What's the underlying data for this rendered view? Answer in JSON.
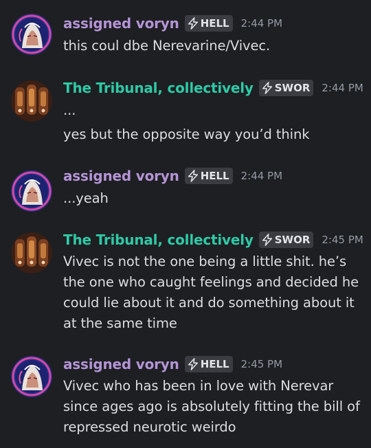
{
  "colors": {
    "background": "#1e1f22",
    "voryn_name": "#b494d6",
    "tribunal_name": "#2fc9a7",
    "message_text": "#dbdee1",
    "timestamp": "#949ba4",
    "tag_bg": "#3a3c41"
  },
  "messages": [
    {
      "author": "assigned voryn",
      "tag": "HELL",
      "tag_icon": "lightning-bolt-icon",
      "time": "2:44 PM",
      "lines": [
        "this coul dbe Nerevarine/Vivec."
      ]
    },
    {
      "author": "The Tribunal, collectively",
      "tag": "SWOR",
      "tag_icon": "lightning-bolt-icon",
      "time": "2:44 PM",
      "lines": [
        "...",
        "yes but the opposite way you’d think"
      ]
    },
    {
      "author": "assigned voryn",
      "tag": "HELL",
      "tag_icon": "lightning-bolt-icon",
      "time": "2:44 PM",
      "lines": [
        "...yeah"
      ]
    },
    {
      "author": "The Tribunal, collectively",
      "tag": "SWOR",
      "tag_icon": "lightning-bolt-icon",
      "time": "2:45 PM",
      "lines": [
        "Vivec is not the one being a little shit. he’s",
        "the one who caught feelings and decided he",
        "could lie about it and do something about it",
        "at the same time"
      ]
    },
    {
      "author": "assigned voryn",
      "tag": "HELL",
      "tag_icon": "lightning-bolt-icon",
      "time": "2:45 PM",
      "lines": [
        "Vivec who has been in love with Nerevar",
        "since ages ago is absolutely fitting the bill of",
        "repressed neurotic weirdo"
      ]
    }
  ]
}
